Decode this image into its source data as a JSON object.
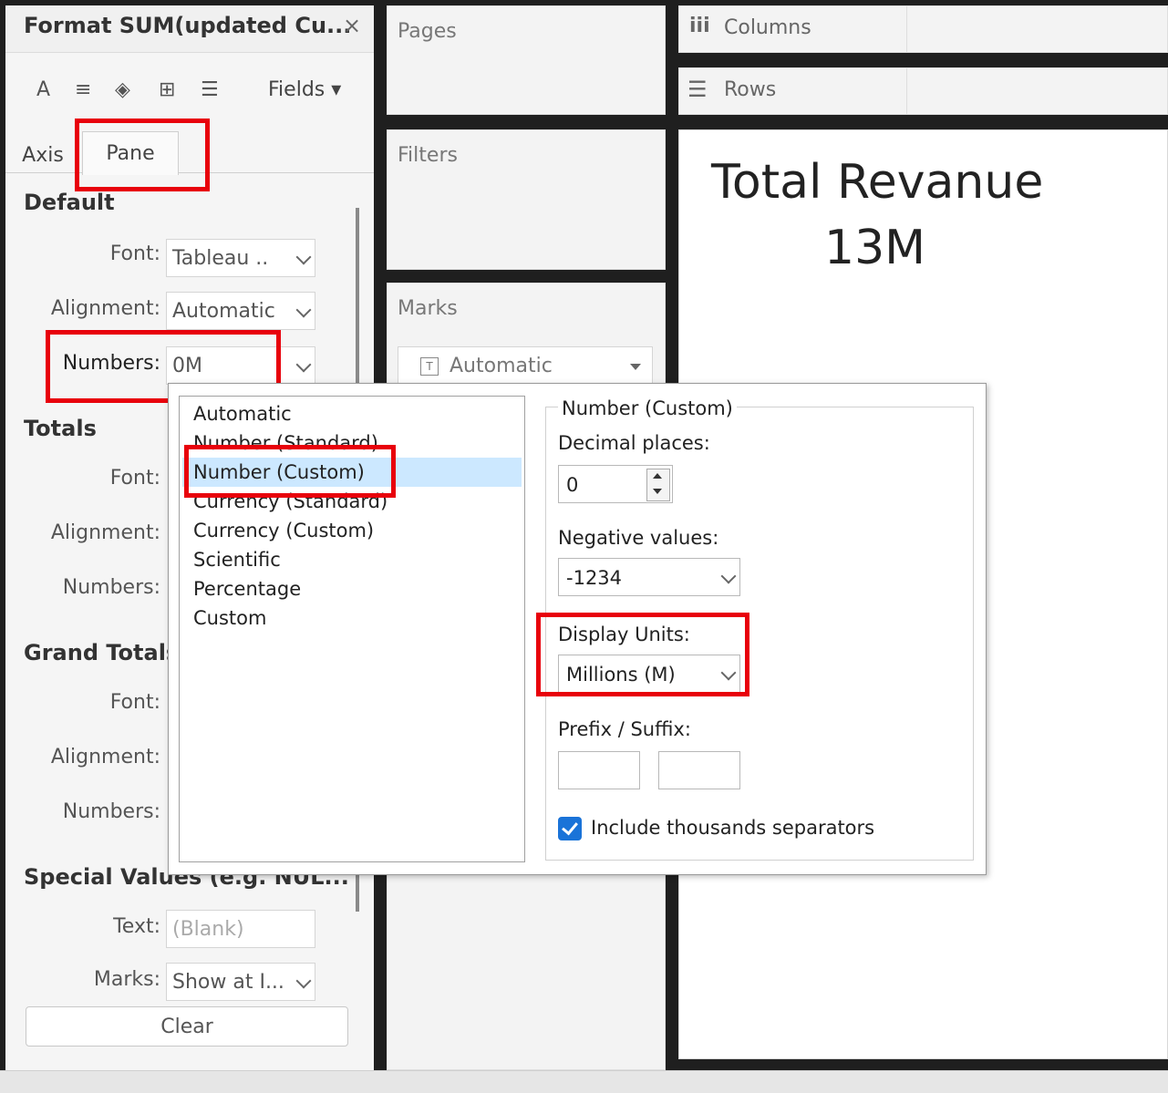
{
  "format_pane": {
    "title": "Format SUM(updated Cu...",
    "close_glyph": "×",
    "toolbar": {
      "font_glyph": "A",
      "align_glyph": "≡",
      "shading_glyph": "◈",
      "borders_glyph": "⊞",
      "lines_glyph": "☰",
      "fields_label": "Fields ▾"
    },
    "tabs": {
      "axis": "Axis",
      "pane": "Pane"
    },
    "default": {
      "heading": "Default",
      "font_label": "Font:",
      "font_value": "Tableau ..",
      "alignment_label": "Alignment:",
      "alignment_value": "Automatic",
      "numbers_label": "Numbers:",
      "numbers_value": "0M"
    },
    "totals": {
      "heading": "Totals",
      "font_label": "Font:",
      "alignment_label": "Alignment:",
      "numbers_label": "Numbers:"
    },
    "grand_totals": {
      "heading": "Grand Totals",
      "font_label": "Font:",
      "alignment_label": "Alignment:",
      "numbers_label": "Numbers:"
    },
    "special_values": {
      "heading": "Special Values (e.g. NUL...",
      "text_label": "Text:",
      "text_placeholder": "(Blank)",
      "marks_label": "Marks:",
      "marks_value": "Show at I..."
    },
    "clear_label": "Clear"
  },
  "shelves": {
    "pages": "Pages",
    "filters": "Filters",
    "marks": "Marks",
    "marks_type": "Automatic",
    "columns": "Columns",
    "rows": "Rows"
  },
  "view": {
    "title": "Total Revanue",
    "value": "13M"
  },
  "number_popup": {
    "formats": [
      "Automatic",
      "Number (Standard)",
      "Number (Custom)",
      "Currency (Standard)",
      "Currency (Custom)",
      "Scientific",
      "Percentage",
      "Custom"
    ],
    "selected_index": 2,
    "group_title": "Number (Custom)",
    "decimal_label": "Decimal places:",
    "decimal_value": "0",
    "negative_label": "Negative values:",
    "negative_value": "-1234",
    "units_label": "Display Units:",
    "units_value": "Millions (M)",
    "prefix_suffix_label": "Prefix / Suffix:",
    "thousands_label": "Include thousands separators",
    "thousands_checked": true
  },
  "colors": {
    "highlight": "#e8000b",
    "selection": "#cce8ff",
    "checkbox": "#1a73d8"
  }
}
